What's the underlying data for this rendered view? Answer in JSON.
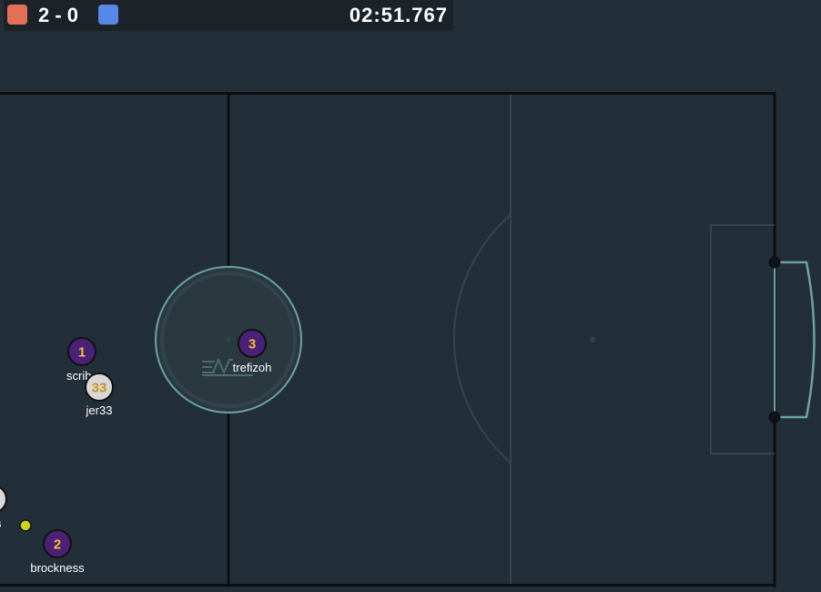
{
  "hud": {
    "red_team_color": "#e56e56",
    "blue_team_color": "#5688e5",
    "score": "2 - 0",
    "timer": "02:51.767"
  },
  "field": {
    "background_color": "#232f38",
    "line_color": "#0b0f12",
    "accent_line_color": "#6aa3a3"
  },
  "players": [
    {
      "id": "p1",
      "number": "1",
      "name": "scrib",
      "team": "red"
    },
    {
      "id": "p3",
      "number": "3",
      "name": "trefizoh",
      "team": "red"
    },
    {
      "id": "p33",
      "number": "33",
      "name": "jer33",
      "team": "blue"
    },
    {
      "id": "p2",
      "number": "2",
      "name": "brockness",
      "team": "red"
    },
    {
      "id": "pX",
      "number": "",
      "name": "s",
      "team": "blue"
    }
  ],
  "ball": {
    "color": "#c8d21a"
  },
  "colors": {
    "red_team_disc": "#4b2078",
    "red_team_number": "#f2c230",
    "blue_team_disc": "#d8d8d8",
    "blue_team_number": "#c8921a"
  }
}
